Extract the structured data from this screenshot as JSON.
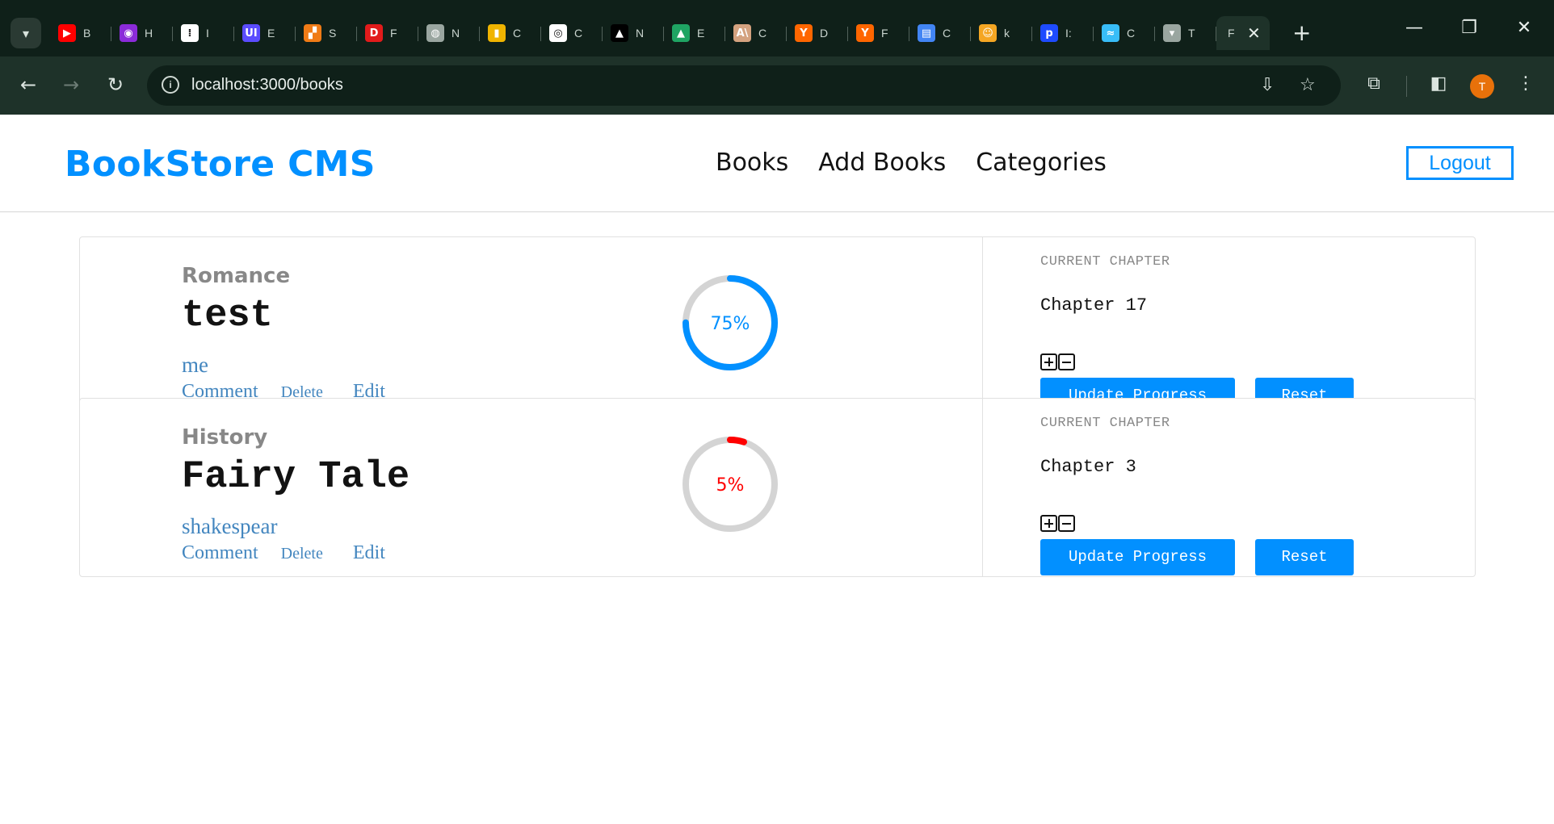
{
  "browser": {
    "tabs": [
      {
        "letter": "B",
        "icon": "youtube-icon",
        "color": "#ff0000",
        "glyph": "▶"
      },
      {
        "letter": "H",
        "icon": "hashnode-icon",
        "color": "#8b2bd9",
        "glyph": "◉"
      },
      {
        "letter": "I",
        "icon": "waveform-icon",
        "color": "#ffffff",
        "glyph": "⁞"
      },
      {
        "letter": "E",
        "icon": "uiverse-icon",
        "color": "#5b4cff",
        "glyph": "UI"
      },
      {
        "letter": "S",
        "icon": "stack-icon",
        "color": "#f07b16",
        "glyph": "▞"
      },
      {
        "letter": "F",
        "icon": "dfont-icon",
        "color": "#e21b1b",
        "glyph": "D"
      },
      {
        "letter": "N",
        "icon": "globe-icon",
        "color": "#9aa6a0",
        "glyph": "◍"
      },
      {
        "letter": "C",
        "icon": "jar-icon",
        "color": "#f0b400",
        "glyph": "▮"
      },
      {
        "letter": "C",
        "icon": "copilot-icon",
        "color": "#ffffff",
        "glyph": "◎"
      },
      {
        "letter": "N",
        "icon": "nextjs-icon",
        "color": "#000000",
        "glyph": "▲"
      },
      {
        "letter": "E",
        "icon": "drive-icon",
        "color": "#1fa463",
        "glyph": "▲"
      },
      {
        "letter": "C",
        "icon": "anthropic-icon",
        "color": "#d4a27f",
        "glyph": "A\\"
      },
      {
        "letter": "D",
        "icon": "ycombinator-icon",
        "color": "#ff6600",
        "glyph": "Y"
      },
      {
        "letter": "F",
        "icon": "ycombinator-icon",
        "color": "#ff6600",
        "glyph": "Y"
      },
      {
        "letter": "C",
        "icon": "docs-icon",
        "color": "#4285f4",
        "glyph": "▤"
      },
      {
        "letter": "k",
        "icon": "cat-icon",
        "color": "#f5a623",
        "glyph": "☺"
      },
      {
        "letter": "I:",
        "icon": "p-icon",
        "color": "#1e4bff",
        "glyph": "p"
      },
      {
        "letter": "C",
        "icon": "tailwind-icon",
        "color": "#38bdf8",
        "glyph": "≈"
      },
      {
        "letter": "T",
        "icon": "cup-icon",
        "color": "#9aa6a0",
        "glyph": "▾"
      }
    ],
    "active_tab_letter": "F",
    "url": "localhost:3000/books"
  },
  "header": {
    "brand": "BookStore CMS",
    "nav": [
      "Books",
      "Add Books",
      "Categories"
    ],
    "logout": "Logout"
  },
  "books": [
    {
      "category": "Romance",
      "title": "test",
      "author": "me",
      "actions": {
        "comment": "Comment",
        "delete": "Delete",
        "edit": "Edit"
      },
      "progress_percent": 75,
      "progress_label": "75%",
      "progress_color": "#0290ff",
      "current_chapter_label": "CURRENT CHAPTER",
      "chapter": "Chapter 17",
      "update_label": "Update Progress",
      "reset_label": "Reset"
    },
    {
      "category": "History",
      "title": "Fairy Tale",
      "author": "shakespear",
      "actions": {
        "comment": "Comment",
        "delete": "Delete",
        "edit": "Edit"
      },
      "progress_percent": 5,
      "progress_label": "5%",
      "progress_color": "#ff0000",
      "current_chapter_label": "CURRENT CHAPTER",
      "chapter": "Chapter 3",
      "update_label": "Update Progress",
      "reset_label": "Reset"
    }
  ],
  "colors": {
    "accent": "#0290ff",
    "ring_track": "#d4d4d4",
    "link": "#4386bf",
    "muted": "#888888"
  }
}
